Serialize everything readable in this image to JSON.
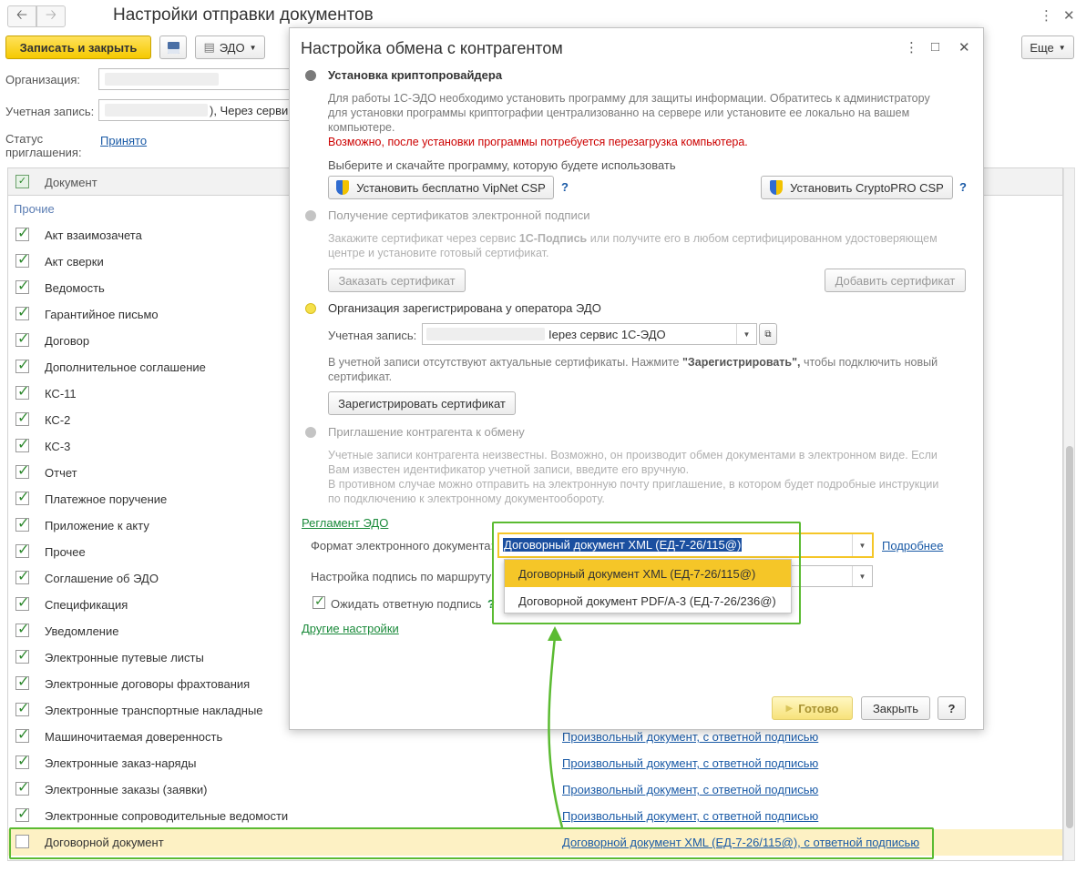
{
  "main": {
    "title": "Настройки отправки документов",
    "toolbar": {
      "save_close": "Записать и закрыть",
      "edo": "ЭДО",
      "more": "Еще"
    },
    "org_label": "Организация:",
    "account_label": "Учетная запись:",
    "account_value": "), Через серви",
    "status_label_1": "Статус",
    "status_label_2": "приглашения:",
    "status_value": "Принято",
    "table": {
      "col_document": "Документ",
      "group": "Прочие",
      "rows": [
        {
          "name": "Акт взаимозачета",
          "checked": true,
          "format": ""
        },
        {
          "name": "Акт сверки",
          "checked": true,
          "format": ""
        },
        {
          "name": "Ведомость",
          "checked": true,
          "format": ""
        },
        {
          "name": "Гарантийное письмо",
          "checked": true,
          "format": ""
        },
        {
          "name": "Договор",
          "checked": true,
          "format": ""
        },
        {
          "name": "Дополнительное соглашение",
          "checked": true,
          "format": ""
        },
        {
          "name": "КС-11",
          "checked": true,
          "format": ""
        },
        {
          "name": "КС-2",
          "checked": true,
          "format": ""
        },
        {
          "name": "КС-3",
          "checked": true,
          "format": ""
        },
        {
          "name": "Отчет",
          "checked": true,
          "format": ""
        },
        {
          "name": "Платежное поручение",
          "checked": true,
          "format": ""
        },
        {
          "name": "Приложение к акту",
          "checked": true,
          "format": ""
        },
        {
          "name": "Прочее",
          "checked": true,
          "format": ""
        },
        {
          "name": "Соглашение об ЭДО",
          "checked": true,
          "format": ""
        },
        {
          "name": "Спецификация",
          "checked": true,
          "format": ""
        },
        {
          "name": "Уведомление",
          "checked": true,
          "format": ""
        },
        {
          "name": "Электронные путевые листы",
          "checked": true,
          "format": ""
        },
        {
          "name": "Электронные договоры фрахтования",
          "checked": true,
          "format": ""
        },
        {
          "name": "Электронные транспортные накладные",
          "checked": true,
          "format": ""
        },
        {
          "name": "Машиночитаемая доверенность",
          "checked": true,
          "format": "Произвольный документ, с ответной подписью"
        },
        {
          "name": "Электронные заказ-наряды",
          "checked": true,
          "format": "Произвольный документ, с ответной подписью"
        },
        {
          "name": "Электронные заказы (заявки)",
          "checked": true,
          "format": "Произвольный документ, с ответной подписью"
        },
        {
          "name": "Электронные сопроводительные ведомости",
          "checked": true,
          "format": "Произвольный документ, с ответной подписью"
        },
        {
          "name": "Договорной документ",
          "checked": false,
          "format": "Договорной документ XML (ЕД-7-26/115@), с ответной подписью"
        }
      ]
    }
  },
  "dialog": {
    "title": "Настройка обмена с контрагентом",
    "step1": {
      "title": "Установка криптопровайдера",
      "desc1": "Для работы 1С-ЭДО необходимо установить программу для защиты информации. Обратитесь к администратору",
      "desc2": "для установки программы криптографии централизованно на сервере или установите ее локально на вашем",
      "desc3": "компьютере.",
      "warning": "Возможно, после установки программы потребуется перезагрузка компьютера.",
      "choose": "Выберите и скачайте программу, которую будете использовать",
      "vipnet": "Установить бесплатно VipNet CSP",
      "cryptopro": "Установить CryptoPRO CSP",
      "help": "?"
    },
    "step2": {
      "title": "Получение сертификатов электронной подписи",
      "desc1a": "Закажите сертификат через сервис ",
      "desc1b": "1С-Подпись",
      "desc1c": " или получите его в любом сертифицированном удостоверяющем",
      "desc2": "центре и установите готовый сертификат.",
      "order": "Заказать сертификат",
      "add": "Добавить сертификат"
    },
    "step3": {
      "title": "Организация зарегистрирована у оператора ЭДО",
      "account_label": "Учетная запись:",
      "account_value": "Iерез сервис 1С-ЭДО",
      "desc1a": "В учетной записи отсутствуют актуальные сертификаты. Нажмите ",
      "desc1b": "\"Зарегистрировать\",",
      "desc1c": " чтобы подключить новый",
      "desc2": "сертификат.",
      "register": "Зарегистрировать сертификат"
    },
    "step4": {
      "title": "Приглашение контрагента к обмену",
      "desc1": "Учетные записи контрагента неизвестны. Возможно, он производит обмен документами в электронном виде. Если",
      "desc2": "Вам известен идентификатор учетной записи, введите его вручную.",
      "desc3": "В противном случае можно отправить на электронную почту приглашение, в котором будет подробные инструкции",
      "desc4": "по подключению к электронному документообороту."
    },
    "reglament": "Регламент ЭДО",
    "format_label": "Формат электронного документа:",
    "format_value": "Договорный документ XML (ЕД-7-26/115@)",
    "more_link": "Подробнее",
    "route_label": "Настройка подпись по маршруту",
    "wait_label": "Ожидать ответную подпись",
    "other": "Другие настройки",
    "options": [
      "Договорный документ XML (ЕД-7-26/115@)",
      "Договорной документ PDF/A-3 (ЕД-7-26/236@)"
    ],
    "ok": "Готово",
    "close": "Закрыть",
    "help": "?"
  },
  "colors": {
    "accent": "#f5c900",
    "green": "#5bbb32",
    "link": "#1a5aa6"
  }
}
